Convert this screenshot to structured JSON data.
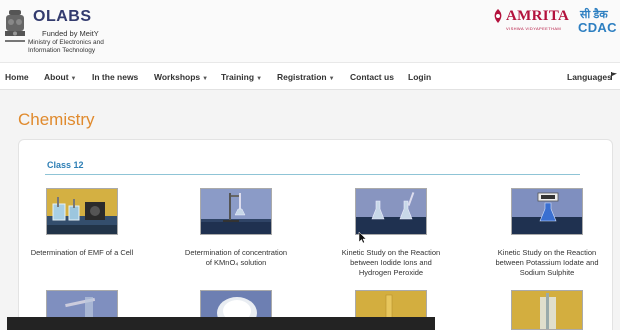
{
  "header": {
    "brand": "OLABS",
    "funded": "Funded by MeitY",
    "ministry": "Ministry of Electronics and Information Technology",
    "partner1": "AMRITA",
    "partner1_sub": "VISHWA VIDYAPEETHAM",
    "partner2_hindi": "सी डैक",
    "partner2": "CDAC"
  },
  "nav": {
    "items": [
      {
        "label": "Home",
        "dropdown": false
      },
      {
        "label": "About",
        "dropdown": true
      },
      {
        "label": "In the news",
        "dropdown": false
      },
      {
        "label": "Workshops",
        "dropdown": true
      },
      {
        "label": "Training",
        "dropdown": true
      },
      {
        "label": "Registration",
        "dropdown": true
      },
      {
        "label": "Contact us",
        "dropdown": false
      },
      {
        "label": "Login",
        "dropdown": false
      }
    ],
    "languages": "Languages",
    "caret": "▼"
  },
  "page": {
    "title": "Chemistry"
  },
  "section": {
    "heading": "Class 12"
  },
  "experiments": [
    {
      "title": "Determination of EMF of a Cell"
    },
    {
      "title": "Determination of concentration of KMnO₄ solution"
    },
    {
      "title": "Kinetic Study on the Reaction between Iodide Ions and Hydrogen Peroxide"
    },
    {
      "title": "Kinetic Study on the Reaction between Potassium Iodate and Sodium Sulphite"
    }
  ],
  "colors": {
    "accent_orange": "#e08a2d",
    "heading_blue": "#2e7fb5",
    "amrita_red": "#b3123d",
    "cdac_blue": "#2d7fc1"
  }
}
